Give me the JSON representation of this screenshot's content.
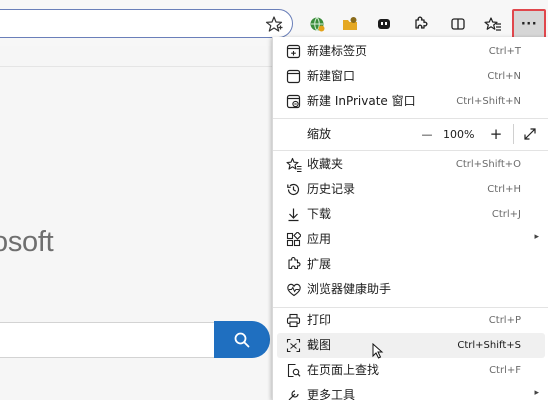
{
  "page": {
    "brand_fragment": "osoft"
  },
  "menu": {
    "new_tab": {
      "label": "新建标签页",
      "shortcut": "Ctrl+T"
    },
    "new_window": {
      "label": "新建窗口",
      "shortcut": "Ctrl+N"
    },
    "new_inprivate": {
      "label": "新建 InPrivate 窗口",
      "shortcut": "Ctrl+Shift+N"
    },
    "zoom": {
      "label": "缩放",
      "minus": "—",
      "value": "100%",
      "plus": "+"
    },
    "favorites": {
      "label": "收藏夹",
      "shortcut": "Ctrl+Shift+O"
    },
    "history": {
      "label": "历史记录",
      "shortcut": "Ctrl+H"
    },
    "downloads": {
      "label": "下载",
      "shortcut": "Ctrl+J"
    },
    "apps": {
      "label": "应用",
      "arrow": "▸"
    },
    "extensions": {
      "label": "扩展"
    },
    "browser_essentials": {
      "label": "浏览器健康助手"
    },
    "print": {
      "label": "打印",
      "shortcut": "Ctrl+P"
    },
    "screenshot": {
      "label": "截图",
      "shortcut": "Ctrl+Shift+S"
    },
    "find_on_page": {
      "label": "在页面上查找",
      "shortcut": "Ctrl+F"
    },
    "more_tools": {
      "label": "更多工具",
      "arrow": "▸"
    }
  },
  "toolbar": {
    "more_label": "···"
  },
  "colors": {
    "accent": "#1f6fc0",
    "highlight_border": "#e0474c"
  }
}
